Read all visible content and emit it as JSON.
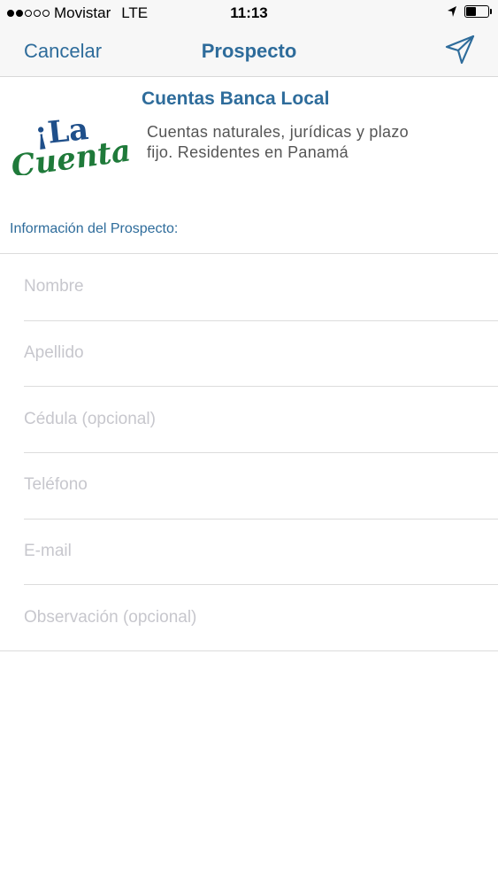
{
  "status_bar": {
    "carrier": "Movistar",
    "network": "LTE",
    "time": "11:13",
    "battery_level": 0.45,
    "signal_bars": 2
  },
  "nav": {
    "cancel_label": "Cancelar",
    "title": "Prospecto",
    "send_icon": "paper-plane-icon"
  },
  "product": {
    "logo_text_top": "¡La",
    "logo_text_bottom": "Cuenta!",
    "title": "Cuentas Banca Local",
    "description": "Cuentas naturales, jurídicas y plazo fijo. Residentes en Panamá"
  },
  "section": {
    "header": "Información del Prospecto:"
  },
  "form": {
    "fields": [
      {
        "placeholder": "Nombre",
        "value": ""
      },
      {
        "placeholder": "Apellido",
        "value": ""
      },
      {
        "placeholder": "Cédula (opcional)",
        "value": ""
      },
      {
        "placeholder": "Teléfono",
        "value": ""
      },
      {
        "placeholder": "E-mail",
        "value": ""
      },
      {
        "placeholder": "Observación (opcional)",
        "value": ""
      }
    ]
  },
  "colors": {
    "accent": "#2e6c9b",
    "logo_blue": "#1f4f8a",
    "logo_green": "#1f7a3a",
    "placeholder": "#c7c7cd"
  }
}
